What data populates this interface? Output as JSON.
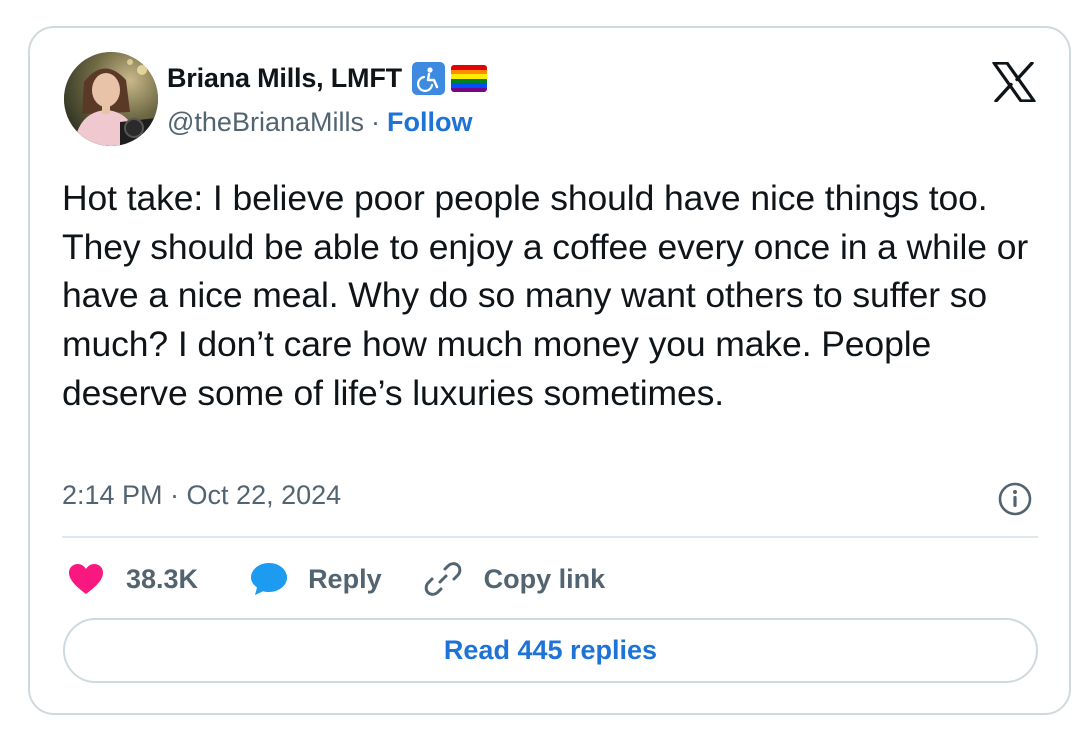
{
  "author": {
    "display_name": "Briana Mills, LMFT",
    "handle": "@theBrianaMills",
    "separator": "·",
    "follow_label": "Follow",
    "badges": [
      "wheelchair-symbol",
      "rainbow-flag"
    ]
  },
  "platform": {
    "logo": "x-logo"
  },
  "tweet": {
    "text": "Hot take: I believe poor people should have nice things too. They should be able to enjoy a coffee every once in a while or have a nice meal. Why do so many want others to suffer so much? I don’t care how much money you make. People deserve some of life’s luxuries sometimes.",
    "timestamp": "2:14 PM · Oct 22, 2024"
  },
  "actions": {
    "like_count": "38.3K",
    "reply_label": "Reply",
    "copy_link_label": "Copy link"
  },
  "footer": {
    "read_replies_label": "Read 445 replies"
  },
  "colors": {
    "accent_blue": "#1d73d6",
    "like_pink": "#f91880",
    "reply_blue": "#1d9bf0",
    "secondary_text": "#536471",
    "border": "#cfd9de"
  }
}
